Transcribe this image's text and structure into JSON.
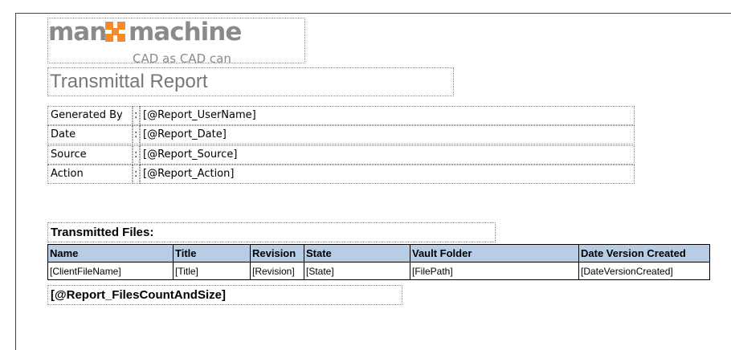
{
  "logo": {
    "left_word": "man",
    "right_word": "machine",
    "tagline": "CAD as CAD can",
    "mark_color": "#f28c28"
  },
  "report": {
    "title": "Transmittal Report"
  },
  "fields": [
    {
      "label": "Generated By",
      "sep": ":",
      "value": "[@Report_UserName]"
    },
    {
      "label": "Date",
      "sep": ":",
      "value": "[@Report_Date]"
    },
    {
      "label": "Source",
      "sep": ":",
      "value": "[@Report_Source]"
    },
    {
      "label": "Action",
      "sep": ":",
      "value": "[@Report_Action]"
    }
  ],
  "transmitted": {
    "heading": "Transmitted Files:",
    "columns": [
      "Name",
      "Title",
      "Revision",
      "State",
      "Vault Folder",
      "Date Version Created"
    ],
    "row": [
      "[ClientFileName]",
      "[Title]",
      "[Revision]",
      "[State]",
      "[FilePath]",
      "[DateVersionCreated]"
    ],
    "header_color": "#b8cce4"
  },
  "footer": {
    "files_count": "[@Report_FilesCountAndSize]"
  }
}
